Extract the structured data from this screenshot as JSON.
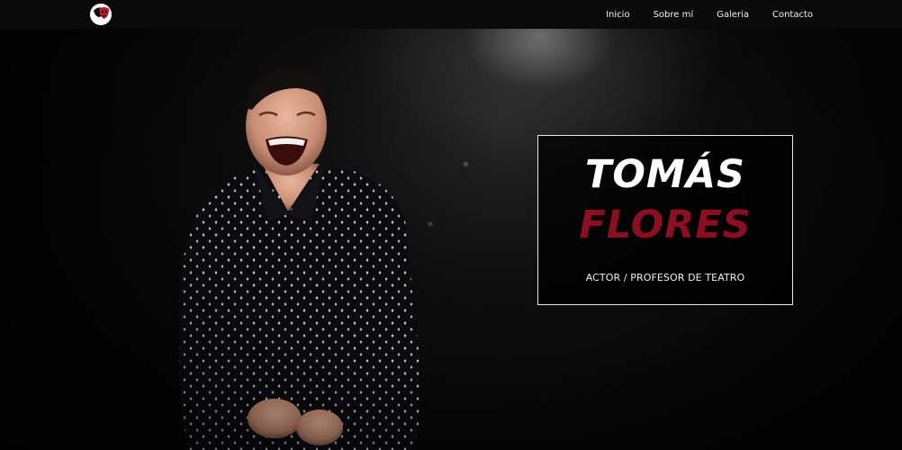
{
  "nav": {
    "logo_icon": "theater-mask-icon",
    "links": [
      {
        "label": "Inicio"
      },
      {
        "label": "Sobre mí"
      },
      {
        "label": "Galeria"
      },
      {
        "label": "Contacto"
      }
    ]
  },
  "hero": {
    "first_name": "TOMÁS",
    "last_name": "FLORES",
    "subtitle": "ACTOR / PROFESOR DE TEATRO"
  },
  "colors": {
    "accent": "#8c0f21",
    "text": "#ffffff",
    "background": "#050505"
  }
}
